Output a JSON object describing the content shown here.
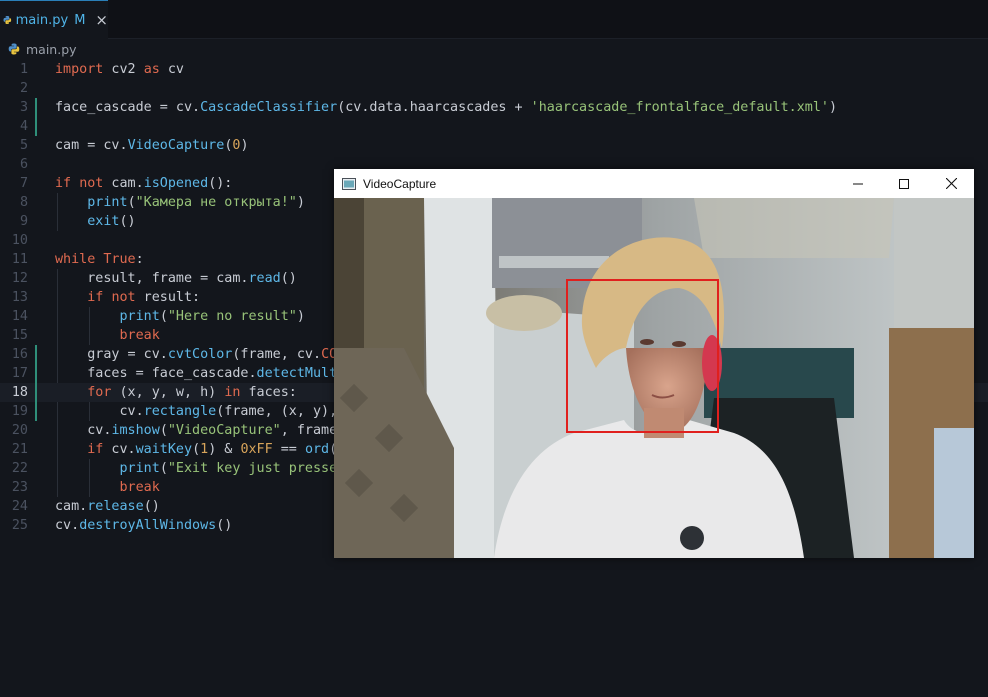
{
  "editor": {
    "tab": {
      "label": "main.py",
      "modified": "M",
      "close": "×"
    },
    "breadcrumb": "main.py",
    "active_line": 18,
    "lines": [
      {
        "n": "1",
        "tokens": [
          {
            "t": "import",
            "c": "k"
          },
          {
            "t": " cv2 ",
            "c": "t"
          },
          {
            "t": "as",
            "c": "k"
          },
          {
            "t": " cv",
            "c": "t"
          }
        ]
      },
      {
        "n": "2",
        "tokens": []
      },
      {
        "n": "3",
        "tokens": [
          {
            "t": "face_cascade = cv.",
            "c": "t"
          },
          {
            "t": "CascadeClassifier",
            "c": "fn"
          },
          {
            "t": "(cv.data.haarcascades + ",
            "c": "t"
          },
          {
            "t": "'haarcascade_frontalface_default.xml'",
            "c": "s"
          },
          {
            "t": ")",
            "c": "t"
          }
        ]
      },
      {
        "n": "4",
        "tokens": []
      },
      {
        "n": "5",
        "tokens": [
          {
            "t": "cam = cv.",
            "c": "t"
          },
          {
            "t": "VideoCapture",
            "c": "fn"
          },
          {
            "t": "(",
            "c": "t"
          },
          {
            "t": "0",
            "c": "n"
          },
          {
            "t": ")",
            "c": "t"
          }
        ]
      },
      {
        "n": "6",
        "tokens": []
      },
      {
        "n": "7",
        "tokens": [
          {
            "t": "if",
            "c": "k"
          },
          {
            "t": " ",
            "c": "t"
          },
          {
            "t": "not",
            "c": "k"
          },
          {
            "t": " cam.",
            "c": "t"
          },
          {
            "t": "isOpened",
            "c": "fn"
          },
          {
            "t": "():",
            "c": "t"
          }
        ]
      },
      {
        "n": "8",
        "tokens": [
          {
            "t": "    ",
            "c": "t"
          },
          {
            "t": "print",
            "c": "fn"
          },
          {
            "t": "(",
            "c": "t"
          },
          {
            "t": "\"Камера не открыта!\"",
            "c": "s"
          },
          {
            "t": ")",
            "c": "t"
          }
        ]
      },
      {
        "n": "9",
        "tokens": [
          {
            "t": "    ",
            "c": "t"
          },
          {
            "t": "exit",
            "c": "fn"
          },
          {
            "t": "()",
            "c": "t"
          }
        ]
      },
      {
        "n": "10",
        "tokens": []
      },
      {
        "n": "11",
        "tokens": [
          {
            "t": "while",
            "c": "k"
          },
          {
            "t": " ",
            "c": "t"
          },
          {
            "t": "True",
            "c": "k"
          },
          {
            "t": ":",
            "c": "t"
          }
        ]
      },
      {
        "n": "12",
        "tokens": [
          {
            "t": "    result, frame = cam.",
            "c": "t"
          },
          {
            "t": "read",
            "c": "fn"
          },
          {
            "t": "()",
            "c": "t"
          }
        ]
      },
      {
        "n": "13",
        "tokens": [
          {
            "t": "    ",
            "c": "t"
          },
          {
            "t": "if",
            "c": "k"
          },
          {
            "t": " ",
            "c": "t"
          },
          {
            "t": "not",
            "c": "k"
          },
          {
            "t": " result:",
            "c": "t"
          }
        ]
      },
      {
        "n": "14",
        "tokens": [
          {
            "t": "        ",
            "c": "t"
          },
          {
            "t": "print",
            "c": "fn"
          },
          {
            "t": "(",
            "c": "t"
          },
          {
            "t": "\"Here no result\"",
            "c": "s"
          },
          {
            "t": ")",
            "c": "t"
          }
        ]
      },
      {
        "n": "15",
        "tokens": [
          {
            "t": "        ",
            "c": "t"
          },
          {
            "t": "break",
            "c": "k"
          }
        ]
      },
      {
        "n": "16",
        "tokens": [
          {
            "t": "    gray = cv.",
            "c": "t"
          },
          {
            "t": "cvtColor",
            "c": "fn"
          },
          {
            "t": "(frame, cv.",
            "c": "t"
          },
          {
            "t": "COLO",
            "c": "k"
          }
        ]
      },
      {
        "n": "17",
        "tokens": [
          {
            "t": "    faces = face_cascade.",
            "c": "t"
          },
          {
            "t": "detectMulti",
            "c": "fn"
          }
        ]
      },
      {
        "n": "18",
        "tokens": [
          {
            "t": "    ",
            "c": "t"
          },
          {
            "t": "for",
            "c": "k"
          },
          {
            "t": " (x, y, w, h) ",
            "c": "t"
          },
          {
            "t": "in",
            "c": "k"
          },
          {
            "t": " faces:",
            "c": "t"
          }
        ]
      },
      {
        "n": "19",
        "tokens": [
          {
            "t": "        cv.",
            "c": "t"
          },
          {
            "t": "rectangle",
            "c": "fn"
          },
          {
            "t": "(frame, (x, y),",
            "c": "t"
          }
        ]
      },
      {
        "n": "20",
        "tokens": [
          {
            "t": "    cv.",
            "c": "t"
          },
          {
            "t": "imshow",
            "c": "fn"
          },
          {
            "t": "(",
            "c": "t"
          },
          {
            "t": "\"VideoCapture\"",
            "c": "s"
          },
          {
            "t": ", frame)",
            "c": "t"
          }
        ]
      },
      {
        "n": "21",
        "tokens": [
          {
            "t": "    ",
            "c": "t"
          },
          {
            "t": "if",
            "c": "k"
          },
          {
            "t": " cv.",
            "c": "t"
          },
          {
            "t": "waitKey",
            "c": "fn"
          },
          {
            "t": "(",
            "c": "t"
          },
          {
            "t": "1",
            "c": "n"
          },
          {
            "t": ") & ",
            "c": "t"
          },
          {
            "t": "0xFF",
            "c": "n"
          },
          {
            "t": " == ",
            "c": "t"
          },
          {
            "t": "ord",
            "c": "fn"
          },
          {
            "t": "('",
            "c": "t"
          }
        ]
      },
      {
        "n": "22",
        "tokens": [
          {
            "t": "        ",
            "c": "t"
          },
          {
            "t": "print",
            "c": "fn"
          },
          {
            "t": "(",
            "c": "t"
          },
          {
            "t": "\"Exit key just pressed",
            "c": "s"
          }
        ]
      },
      {
        "n": "23",
        "tokens": [
          {
            "t": "        ",
            "c": "t"
          },
          {
            "t": "break",
            "c": "k"
          }
        ]
      },
      {
        "n": "24",
        "tokens": [
          {
            "t": "cam.",
            "c": "t"
          },
          {
            "t": "release",
            "c": "fn"
          },
          {
            "t": "()",
            "c": "t"
          }
        ]
      },
      {
        "n": "25",
        "tokens": [
          {
            "t": "cv.",
            "c": "t"
          },
          {
            "t": "destroyAllWindows",
            "c": "fn"
          },
          {
            "t": "()",
            "c": "t"
          }
        ]
      }
    ]
  },
  "video_window": {
    "title": "VideoCapture",
    "controls": [
      "minimize-icon",
      "maximize-icon",
      "close-icon"
    ],
    "face_box_color": "#e0201e"
  },
  "colors": {
    "keyword": "#e06a50",
    "function": "#5eb8e8",
    "string": "#98c379",
    "number": "#d7a45a"
  }
}
